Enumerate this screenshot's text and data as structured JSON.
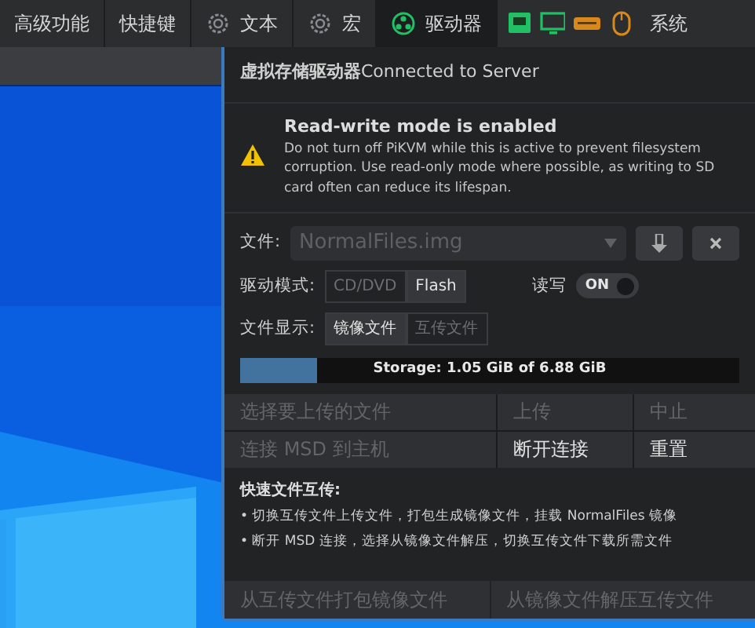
{
  "menubar": {
    "items": [
      {
        "kind": "text",
        "label": "高级功能",
        "selected": false
      },
      {
        "kind": "text",
        "label": "快捷键",
        "selected": false
      },
      {
        "kind": "gear",
        "label": "文本",
        "selected": false
      },
      {
        "kind": "gear",
        "label": "宏",
        "selected": false
      },
      {
        "kind": "drive",
        "label": "驱动器",
        "selected": true
      }
    ],
    "indicators": [
      {
        "kind": "network",
        "color": "#22c064"
      },
      {
        "kind": "monitor",
        "color": "#22c064"
      },
      {
        "kind": "keyboard",
        "color": "#d9891c"
      },
      {
        "kind": "mouse",
        "color": "#d9891c"
      }
    ],
    "system_label": "系统"
  },
  "panel": {
    "title": "**虚拟存储驱动器**Connected to Server",
    "warning": {
      "title": "Read-write mode is enabled",
      "text": "Do not turn off PiKVM while this is active to prevent filesystem corruption. Use read-only mode where possible, as writing to SD card often can reduce its lifespan."
    },
    "file": {
      "label": "文件:",
      "value": "NormalFiles.img",
      "disabled": true
    },
    "mode": {
      "label": "驱动模式:",
      "options": [
        {
          "label": "CD/DVD",
          "selected": false
        },
        {
          "label": "Flash",
          "selected": true
        }
      ]
    },
    "rw": {
      "label": "读写",
      "switch_label": "ON",
      "on": true
    },
    "display": {
      "label": "文件显示:",
      "options": [
        {
          "label": "镜像文件",
          "selected": true
        },
        {
          "label": "互传文件",
          "selected": false
        }
      ]
    },
    "storage": {
      "level": 0.153,
      "text": "Storage: 1.05 GiB of 6.88 GiB"
    },
    "actions": [
      [
        {
          "label": "选择要上传的文件",
          "disabled": true
        },
        {
          "label": "上传",
          "disabled": true
        },
        {
          "label": "中止",
          "disabled": true
        }
      ],
      [
        {
          "label": "连接 MSD 到主机",
          "disabled": true
        },
        {
          "label": "断开连接",
          "disabled": false
        },
        {
          "label": "重置",
          "disabled": false
        }
      ]
    ],
    "help": {
      "title": "快速文件互传:",
      "lines": [
        "• 切换互传文件上传文件，打包生成镜像文件，挂载 NormalFiles 镜像",
        "• 断开 MSD 连接，选择从镜像文件解压，切换互传文件下载所需文件"
      ]
    },
    "bottom_actions": [
      {
        "label": "从互传文件打包镜像文件",
        "disabled": true
      },
      {
        "label": "从镜像文件解压互传文件",
        "disabled": true
      }
    ]
  }
}
